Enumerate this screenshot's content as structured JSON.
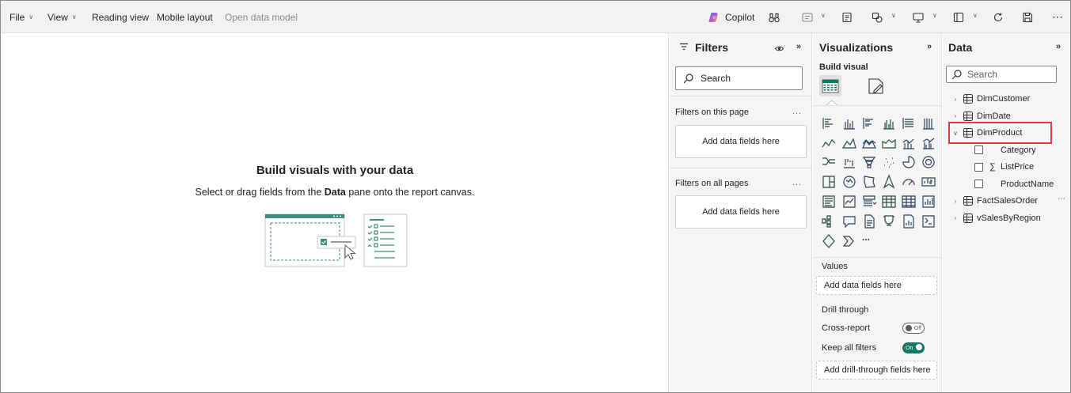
{
  "toolbar": {
    "file": "File",
    "view": "View",
    "reading_view": "Reading view",
    "mobile_layout": "Mobile layout",
    "open_data_model": "Open data model",
    "copilot": "Copilot",
    "more": "⋯"
  },
  "canvas": {
    "title": "Build visuals with your data",
    "subtitle_pre": "Select or drag fields from the ",
    "subtitle_bold": "Data",
    "subtitle_post": " pane onto the report canvas."
  },
  "filters": {
    "title": "Filters",
    "search_placeholder": "Search",
    "on_this_page": "Filters on this page",
    "on_all_pages": "Filters on all pages",
    "add_fields": "Add data fields here",
    "dots": "..."
  },
  "visualizations": {
    "title": "Visualizations",
    "build_visual": "Build visual",
    "more_visuals": "...",
    "values_label": "Values",
    "values_drop": "Add data fields here",
    "drill_through": "Drill through",
    "cross_report": "Cross-report",
    "cross_report_state": "Off",
    "keep_all_filters": "Keep all filters",
    "keep_all_filters_state": "On",
    "drill_drop": "Add drill-through fields here"
  },
  "data": {
    "title": "Data",
    "search_placeholder": "Search",
    "tables": [
      {
        "name": "DimCustomer",
        "expanded": false
      },
      {
        "name": "DimDate",
        "expanded": false
      },
      {
        "name": "DimProduct",
        "expanded": true,
        "fields": [
          {
            "name": "Category",
            "sum": false
          },
          {
            "name": "ListPrice",
            "sum": true
          },
          {
            "name": "ProductName",
            "sum": false
          }
        ]
      },
      {
        "name": "FactSalesOrder",
        "expanded": false
      },
      {
        "name": "vSalesByRegion",
        "expanded": false
      }
    ],
    "more": "⋯"
  },
  "colors": {
    "accent_teal": "#117865",
    "highlight_red": "#e03a3e"
  }
}
